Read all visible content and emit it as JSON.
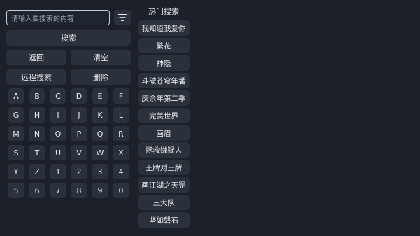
{
  "search": {
    "placeholder": "请输入要搜索的内容",
    "search_label": "搜索",
    "back_label": "返回",
    "clear_label": "清空",
    "remote_label": "远程搜索",
    "delete_label": "删除"
  },
  "filter_icon": "filter-icon",
  "keyboard": {
    "rows": [
      [
        "A",
        "B",
        "C",
        "D",
        "E",
        "F"
      ],
      [
        "G",
        "H",
        "I",
        "J",
        "K",
        "L"
      ],
      [
        "M",
        "N",
        "O",
        "P",
        "Q",
        "R"
      ],
      [
        "S",
        "T",
        "U",
        "V",
        "W",
        "X"
      ],
      [
        "Y",
        "Z",
        "1",
        "2",
        "3",
        "4"
      ],
      [
        "5",
        "6",
        "7",
        "8",
        "9",
        "0"
      ]
    ]
  },
  "hot": {
    "title": "热门搜索",
    "items": [
      "我知道我爱你",
      "繁花",
      "神隐",
      "斗破苍穹年番",
      "庆余年第二季",
      "完美世界",
      "画眉",
      "拯救嫌疑人",
      "王牌对王牌",
      "画江湖之天罡",
      "三大队",
      "坚如磐石"
    ]
  }
}
